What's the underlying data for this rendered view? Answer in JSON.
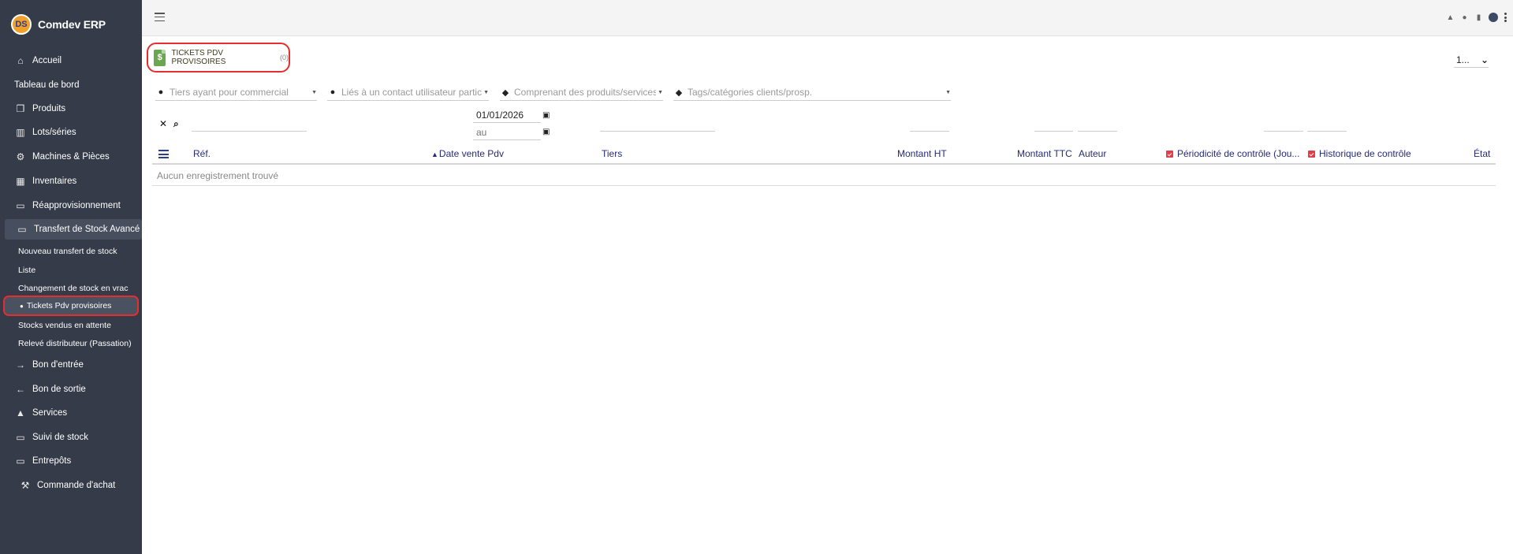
{
  "app": {
    "name": "Comdev ERP",
    "logo_text": "DS"
  },
  "sidebar": {
    "items": [
      {
        "label": "Accueil",
        "icon": "home-icon"
      },
      {
        "label": "Tableau de bord",
        "icon": ""
      },
      {
        "label": "Produits",
        "icon": "cube-icon"
      },
      {
        "label": "Lots/séries",
        "icon": "barcode-icon"
      },
      {
        "label": "Machines & Pièces",
        "icon": "cogs-icon"
      },
      {
        "label": "Inventaires",
        "icon": "boxes-icon"
      },
      {
        "label": "Réapprovisionnement",
        "icon": "box-open-icon"
      },
      {
        "label": "Transfert de Stock Avancé",
        "icon": "box-open-icon"
      }
    ],
    "subitems": [
      {
        "label": "Nouveau transfert de stock"
      },
      {
        "label": "Liste"
      },
      {
        "label": "Changement de stock en vrac"
      },
      {
        "label": "Tickets Pdv provisoires"
      },
      {
        "label": "Stocks vendus en attente"
      },
      {
        "label": "Relevé distributeur (Passation)"
      }
    ],
    "items2": [
      {
        "label": "Bon d'entrée",
        "icon": "arrow-right-icon"
      },
      {
        "label": "Bon de sortie",
        "icon": "arrow-left-icon"
      },
      {
        "label": "Services",
        "icon": "bell-icon"
      },
      {
        "label": "Suivi de stock",
        "icon": "box-open-icon"
      },
      {
        "label": "Entrepôts",
        "icon": "box-open-icon"
      },
      {
        "label": "Commande d'achat",
        "icon": "dolly-icon"
      }
    ]
  },
  "page": {
    "title": "TICKETS PDV PROVISOIRES",
    "count": "(0)",
    "pager_value": "1..."
  },
  "filters": {
    "commercial": "Tiers ayant pour commercial",
    "contact": "Liés à un contact utilisateur partic",
    "produits": "Comprenant des produits/services",
    "tags": "Tags/catégories clients/prosp."
  },
  "search": {
    "date_from": "01/01/2026",
    "date_to_placeholder": "au"
  },
  "table": {
    "columns": {
      "ref": "Réf.",
      "date": "Date vente Pdv",
      "tiers": "Tiers",
      "montant_ht": "Montant HT",
      "montant_ttc": "Montant TTC",
      "auteur": "Auteur",
      "periodicite": "Périodicité de contrôle (Jou...",
      "historique": "Historique de contrôle",
      "etat": "État"
    },
    "empty_message": "Aucun enregistrement trouvé"
  }
}
